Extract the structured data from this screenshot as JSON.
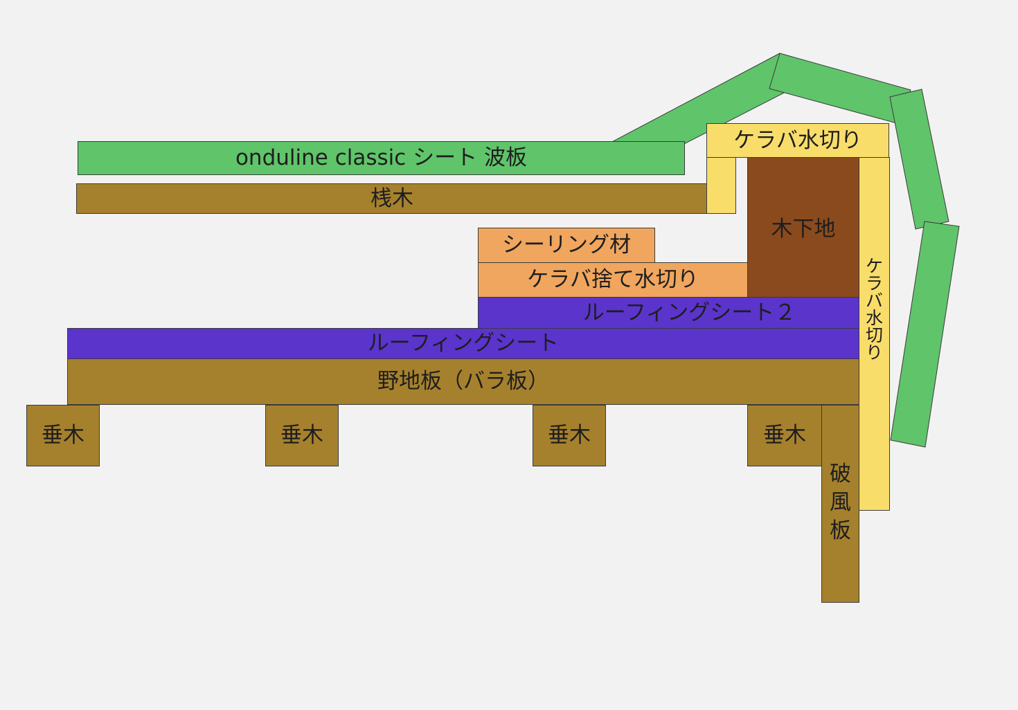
{
  "colors": {
    "background": "#f2f2f2",
    "corrugated_sheet": "#60c46a",
    "wood": "#a6812d",
    "wood_base": "#8b4a1d",
    "flashing": "#f9dd6b",
    "sealing": "#f0a65e",
    "roofing": "#5b34cc"
  },
  "labels": {
    "onduline": "onduline classic シート 波板",
    "batten": "桟木",
    "verge_flashing_top": "ケラバ水切り",
    "wood_base": "木下地",
    "sealing": "シーリング材",
    "verge_under_flashing": "ケラバ捨て水切り",
    "roofing_sheet_2": "ルーフィングシート２",
    "roofing_sheet": "ルーフィングシート",
    "sheathing": "野地板（バラ板）",
    "rafter": "垂木",
    "verge_flashing_side": "ケラバ水切り",
    "barge_board": "破風板"
  }
}
